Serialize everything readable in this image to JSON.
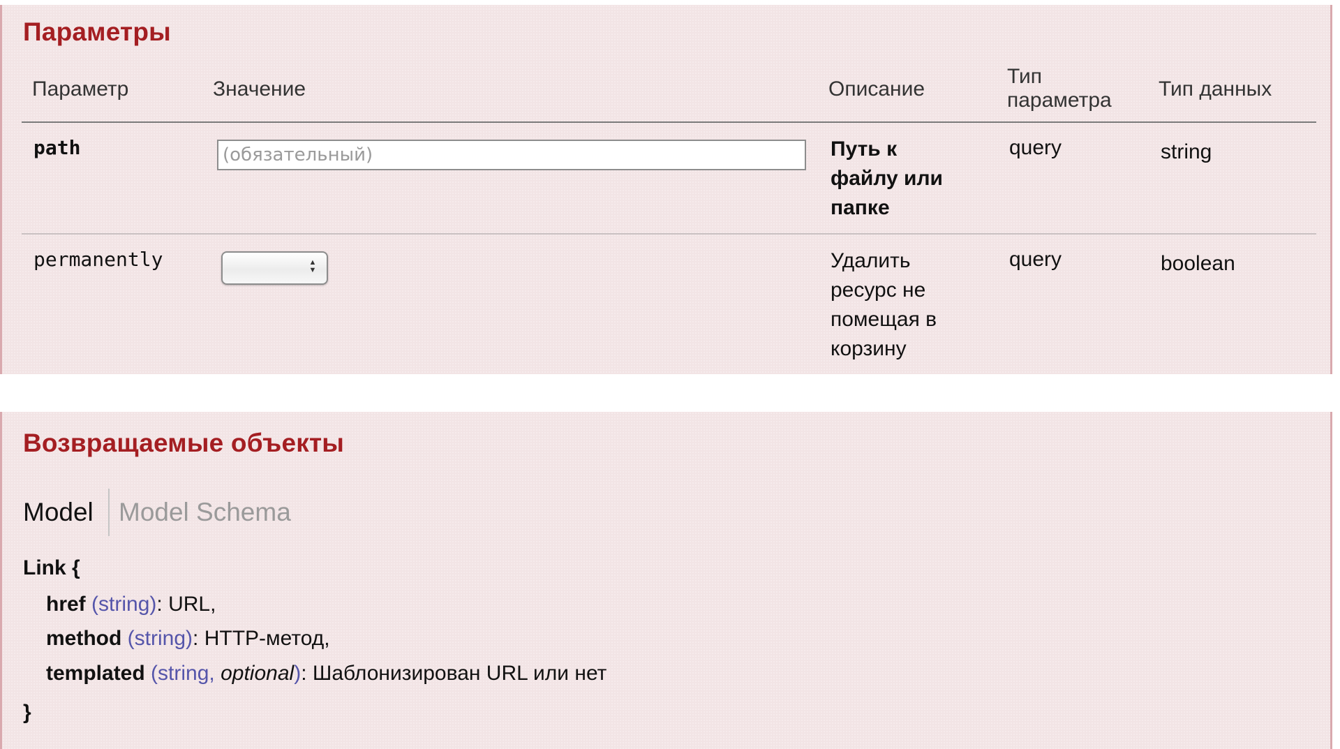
{
  "parameters_panel": {
    "title": "Параметры",
    "columns": [
      "Параметр",
      "Значение",
      "Описание",
      "Тип параметра",
      "Тип данных"
    ],
    "column_type_param_lines": [
      "Тип",
      "параметра"
    ],
    "rows": [
      {
        "name": "path",
        "value_control": "text-input",
        "value": "",
        "placeholder": "(обязательный)",
        "description_lines": [
          "Путь к",
          "файлу или",
          "папке"
        ],
        "description_bold": true,
        "param_type": "query",
        "data_type": "string"
      },
      {
        "name": "permanently",
        "value_control": "select",
        "selected": "",
        "description_lines": [
          "Удалить",
          "ресурс не",
          "помещая в",
          "корзину"
        ],
        "description_bold": false,
        "param_type": "query",
        "data_type": "boolean"
      }
    ]
  },
  "returns_panel": {
    "title": "Возвращаемые объекты",
    "tabs": [
      {
        "label": "Model",
        "active": true
      },
      {
        "label": "Model Schema",
        "active": false
      }
    ],
    "model": {
      "open": "Link {",
      "close": "}",
      "fields": [
        {
          "name": "href",
          "type": "string",
          "optional": false,
          "description": "URL,"
        },
        {
          "name": "method",
          "type": "string",
          "optional": false,
          "description": "HTTP-метод,"
        },
        {
          "name": "templated",
          "type": "string",
          "optional": true,
          "optional_label": "optional",
          "description": "Шаблонизирован URL или нет"
        }
      ]
    }
  },
  "colors": {
    "panel_bg": "#f2e4e5",
    "panel_border": "#d9a9ae",
    "title": "#a41e22",
    "type_link": "#5555aa",
    "inactive_tab": "#9a9a9a"
  }
}
